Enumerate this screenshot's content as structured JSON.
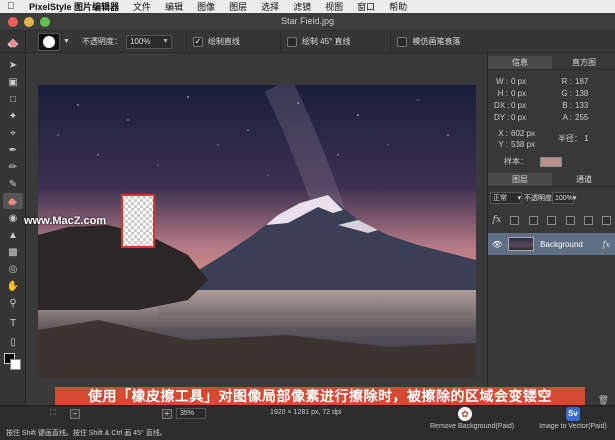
{
  "menubar": {
    "app_name": "PixelStyle 图片编辑器",
    "items": [
      "文件",
      "编辑",
      "图像",
      "图层",
      "选择",
      "滤镜",
      "视图",
      "窗口",
      "帮助"
    ]
  },
  "window": {
    "title": "Star Field.jpg"
  },
  "options": {
    "opacity_label": "不透明度：",
    "opacity_value": "100%",
    "draw_line_label": "绘制直线",
    "draw_45_label": "绘制 45° 直线",
    "mimic_label": "模仿画笔衰落"
  },
  "info_panel": {
    "tab_info": "信息",
    "tab_histogram": "直方图",
    "w": "0 px",
    "h": "0 px",
    "dx": "0 px",
    "dy": "0 px",
    "r": "187",
    "g": "138",
    "b": "133",
    "a": "255",
    "x": "602 px",
    "y": "538 px",
    "radius_label": "半径：",
    "radius_value": "1",
    "sample_label": "样本："
  },
  "layers_panel": {
    "tab_layers": "图层",
    "tab_channels": "通道",
    "blend_mode": "正常",
    "opacity_label": "不透明度",
    "opacity_value": "100%",
    "layer_name": "Background"
  },
  "status": {
    "zoom_value": "35%",
    "image_info": "1920 × 1281 px, 72 dpi",
    "hint": "按住 Shift 键画直线。按住 Shift & Ctrl 画 45° 直线。",
    "remove_bg_label": "Remove Background(Paid)",
    "vector_label": "Image to Vector(Paid)"
  },
  "caption": "使用「橡皮擦工具」对图像局部像素进行擦除时，被擦除的区域会变镂空",
  "watermark": "www.MacZ.com",
  "colors": {
    "accent": "#d44a33",
    "selected_layer": "#5f6f85",
    "sample_swatch": "#b88f8b"
  }
}
